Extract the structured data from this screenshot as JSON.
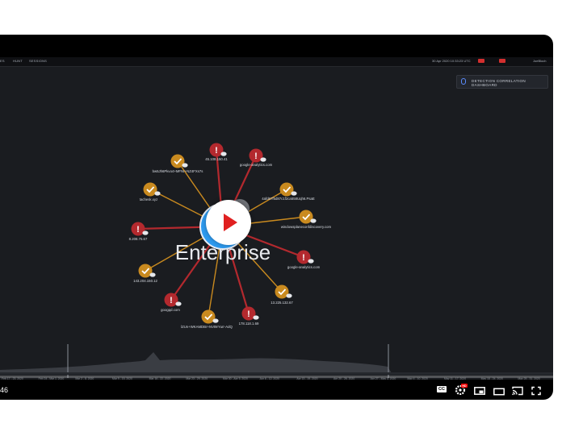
{
  "app": {
    "nav_items": [
      "ES",
      "HUNT",
      "SESSIONS"
    ],
    "top_right": {
      "datetime": "30 Apr 2020 10:33:23 UTC",
      "user": "JoeBloch"
    },
    "dashboard_button": "DETECTION CORRELATION DASHBOARD"
  },
  "graph": {
    "center_label": "Enterprise",
    "center_count": "1",
    "nodes": [
      {
        "label": "45.108.150.41",
        "status": "alert"
      },
      {
        "label": "google-analytics.com",
        "status": "alert"
      },
      {
        "label": "4afd67f5d87c1f2ca558Uqh6.PsaE",
        "status": "ok"
      },
      {
        "label": "windowsplaneconfdiscovery.com",
        "status": "ok"
      },
      {
        "label": "google-analytics.com",
        "status": "alert"
      },
      {
        "label": "13.225.132.67",
        "status": "ok"
      },
      {
        "label": "178.118.1.69",
        "status": "alert"
      },
      {
        "label": "lZUn+WKAMDBr+NVt9rYurr-AdQ",
        "status": "ok"
      },
      {
        "label": "googqd.com",
        "status": "alert"
      },
      {
        "label": "143.204.150.12",
        "status": "ok"
      },
      {
        "label": "8.208.75.67",
        "status": "alert"
      },
      {
        "label": "tachesk.xyz",
        "status": "ok"
      },
      {
        "label": "bw5Jh6Pkvo4+MFNr+NZ4FXs7s",
        "status": "ok"
      }
    ],
    "colors": {
      "alert": "#b3292e",
      "ok": "#c98a1f",
      "center": "#2e9bf0",
      "background": "#1a1c20"
    }
  },
  "timeline": {
    "ranges": [
      "Feb 17 - 23, 2020",
      "Feb 24 - Mar 1, 2020",
      "Mar 2 - 8, 2020",
      "Mar 9 - 15, 2020",
      "Mar 16 - 22, 2020",
      "Mar 23 - 29, 2020",
      "Mar 30 - Apr 5, 2020",
      "Apr 6 - 12, 2020",
      "Apr 13 - 19, 2020",
      "Apr 20 - 26, 2020",
      "Apr 27 - May 3, 2020",
      "May 4 - 10, 2020",
      "May 11 - 17, 2020",
      "May 18 - 24, 2020",
      "May 25 - 31, 2020"
    ]
  },
  "player": {
    "time": "46",
    "progress_percent": 0,
    "controls": [
      "cc-icon",
      "settings-icon",
      "miniplayer-icon",
      "theater-icon",
      "cast-icon",
      "fullscreen-icon"
    ],
    "settings_badge": "HD"
  }
}
